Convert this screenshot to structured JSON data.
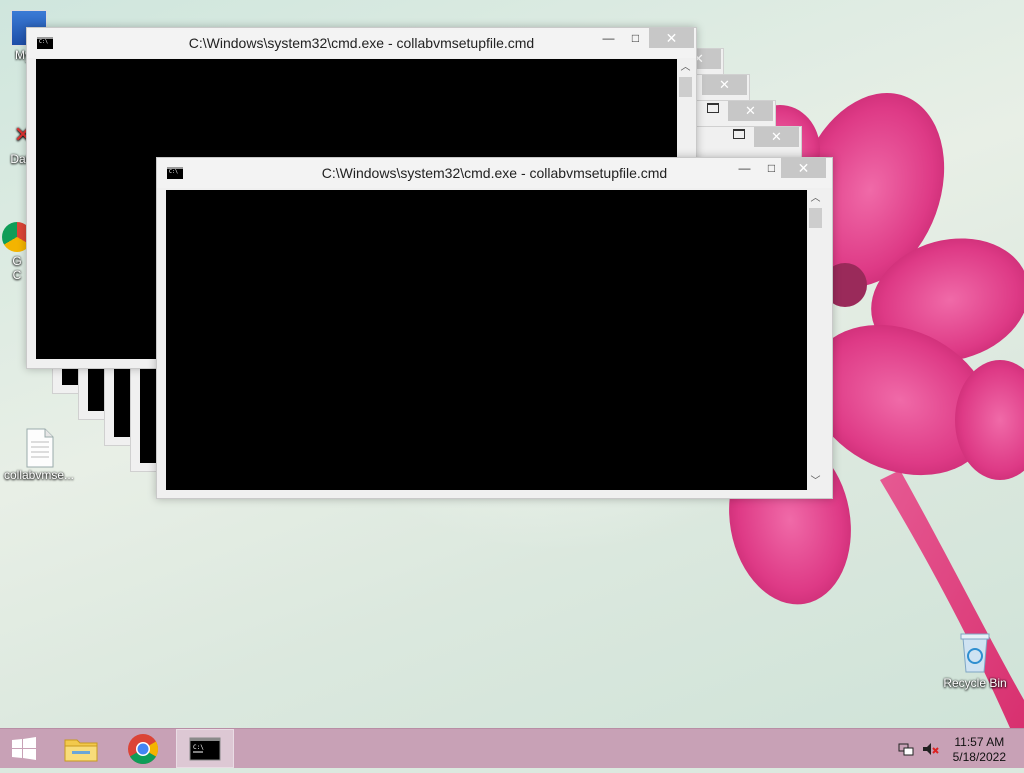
{
  "desktop": {
    "icons": [
      {
        "label": "My C"
      },
      {
        "label": "Data"
      },
      {
        "label": "G\nC"
      },
      {
        "label": "collabvmse..."
      },
      {
        "label": "Recycle Bin"
      }
    ]
  },
  "windows": {
    "back": {
      "title": "C:\\Windows\\system32\\cmd.exe - collabvmsetupfile.cmd",
      "minimize_glyph": "—",
      "maximize_glyph": "□",
      "close_glyph": "✕"
    },
    "front": {
      "title": "C:\\Windows\\system32\\cmd.exe - collabvmsetupfile.cmd",
      "minimize_glyph": "—",
      "maximize_glyph": "□",
      "close_glyph": "✕"
    },
    "ghost_close_glyph": "✕"
  },
  "taskbar": {
    "time": "11:57 AM",
    "date": "5/18/2022"
  },
  "colors": {
    "taskbar": "#c8a1b6",
    "flower": "#e0418c",
    "console": "#000000"
  }
}
